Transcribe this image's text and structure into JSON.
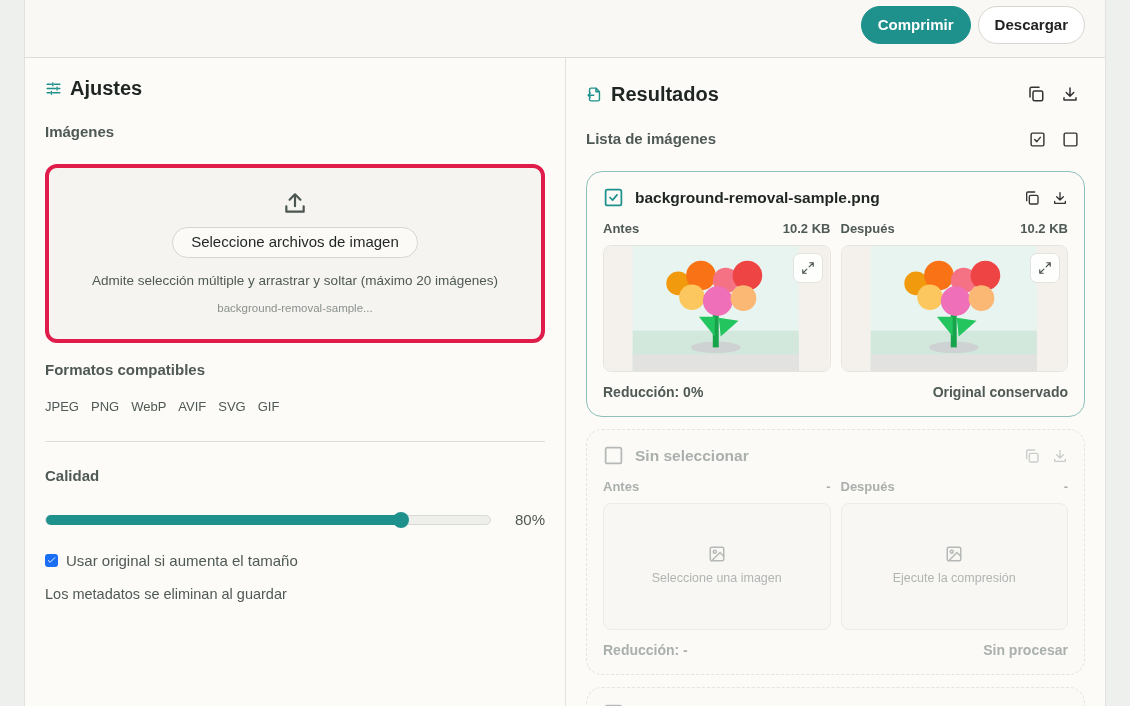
{
  "header": {
    "buttons": [
      {
        "label": "Comprimir",
        "kind": "primary"
      },
      {
        "label": "Descargar",
        "kind": "secondary"
      }
    ]
  },
  "settings": {
    "title": "Ajustes",
    "images_label": "Imágenes",
    "dropzone": {
      "highlighted": true,
      "button": "Seleccione archivos de imagen",
      "hint": "Admite selección múltiple y arrastrar y soltar (máximo 20 imágenes)",
      "file": "background-removal-sample..."
    },
    "formats_label": "Formatos compatibles",
    "formats": [
      "JPEG",
      "PNG",
      "WebP",
      "AVIF",
      "SVG",
      "GIF"
    ],
    "quality_label": "Calidad",
    "quality": {
      "level": 0.8,
      "reading": "80%"
    },
    "keep_original": {
      "label": "Usar original si aumenta el tamaño",
      "checked": true
    },
    "note": "Los metadatos se eliminan al guardar"
  },
  "results": {
    "title": "Resultados",
    "list_label": "Lista de imágenes",
    "items": [
      {
        "kind": "result",
        "selected": true,
        "title": "background-removal-sample.png",
        "before_label": "Antes",
        "before_size": "10.2 KB",
        "after_label": "Después",
        "after_size": "10.2 KB",
        "reduction": "Reducción: 0%",
        "status": "Original conservado"
      },
      {
        "kind": "empty",
        "selected": false,
        "title": "Sin seleccionar",
        "before_label": "Antes",
        "before_size": "-",
        "after_label": "Después",
        "after_size": "-",
        "before_placeholder": "Seleccione una imagen",
        "after_placeholder": "Ejecute la compresión",
        "reduction": "Reducción: -",
        "status": "Sin procesar"
      },
      {
        "kind": "empty",
        "selected": false
      }
    ]
  }
}
